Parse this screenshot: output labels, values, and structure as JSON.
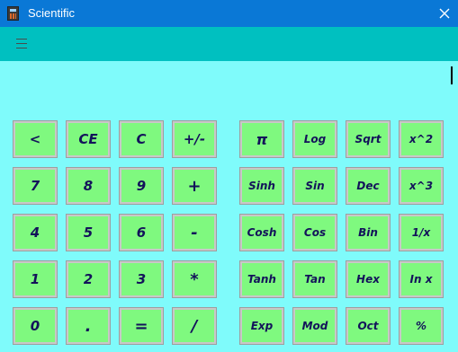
{
  "window": {
    "title": "Scientific",
    "app_icon": "calculator-icon",
    "close_icon": "close-icon"
  },
  "menu": {
    "icon": "hamburger-icon"
  },
  "display": {
    "value": ""
  },
  "colors": {
    "titlebar": "#0a78d6",
    "menubar": "#00c0c0",
    "background": "#7ffbfb",
    "key": "#7ff97f",
    "key_text": "#13135a"
  },
  "keypad": {
    "basic": [
      [
        "<",
        "CE",
        "C",
        "+/-"
      ],
      [
        "7",
        "8",
        "9",
        "+"
      ],
      [
        "4",
        "5",
        "6",
        "-"
      ],
      [
        "1",
        "2",
        "3",
        "*"
      ],
      [
        "0",
        ".",
        "=",
        "/"
      ]
    ],
    "scientific": [
      [
        "π",
        "Log",
        "Sqrt",
        "x^2"
      ],
      [
        "Sinh",
        "Sin",
        "Dec",
        "x^3"
      ],
      [
        "Cosh",
        "Cos",
        "Bin",
        "1/x"
      ],
      [
        "Tanh",
        "Tan",
        "Hex",
        "In x"
      ],
      [
        "Exp",
        "Mod",
        "Oct",
        "%"
      ]
    ]
  }
}
